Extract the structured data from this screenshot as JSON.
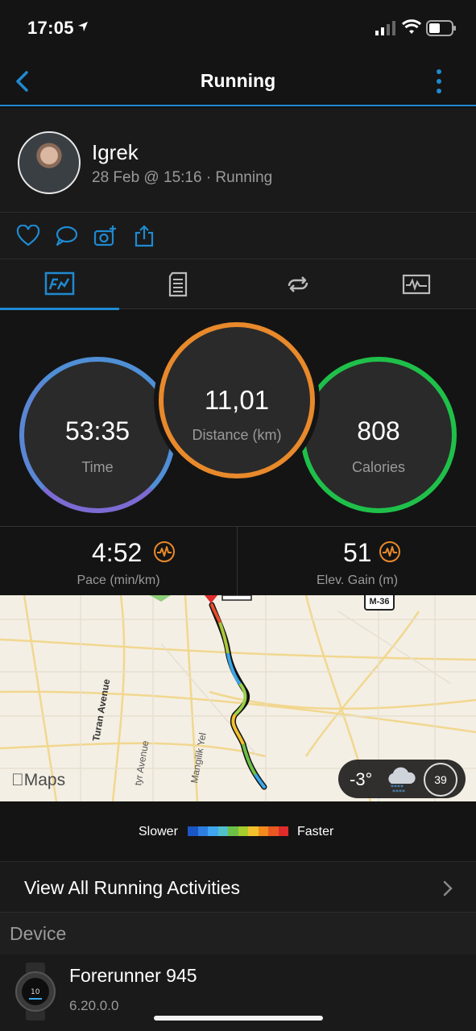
{
  "status_bar": {
    "time": "17:05"
  },
  "nav": {
    "title": "Running"
  },
  "profile": {
    "name": "Igrek",
    "meta": "28 Feb @ 15:16 · Running"
  },
  "actions": [
    "heart-icon",
    "comment-icon",
    "add-photo-icon",
    "share-icon"
  ],
  "tabs": [
    {
      "icon": "stats-icon",
      "active": true
    },
    {
      "icon": "details-icon",
      "active": false
    },
    {
      "icon": "laps-icon",
      "active": false
    },
    {
      "icon": "charts-icon",
      "active": false
    }
  ],
  "stats": {
    "time": {
      "value": "53:35",
      "label": "Time"
    },
    "distance": {
      "value": "11,01",
      "label": "Distance (km)"
    },
    "calories": {
      "value": "808",
      "label": "Calories"
    }
  },
  "secondary_stats": {
    "pace": {
      "value": "4:52",
      "label": "Pace (min/km)"
    },
    "elevation": {
      "value": "51",
      "label": "Elev. Gain (m)"
    }
  },
  "map": {
    "logo": "Maps",
    "shield": "M-36",
    "roads": [
      "Turan Avenue",
      "tyr Avenue",
      "Mangilik Yel"
    ],
    "weather": {
      "temperature": "-3°",
      "index": "39"
    }
  },
  "legend": {
    "slower": "Slower",
    "faster": "Faster",
    "colors": [
      "#1a56c4",
      "#2e7ee0",
      "#3fa6f0",
      "#52c0c8",
      "#6cc046",
      "#a6cc2e",
      "#f2c12e",
      "#f28a1e",
      "#e85820",
      "#e02b2b"
    ]
  },
  "view_all": "View All Running Activities",
  "section_device": "Device",
  "device": {
    "name": "Forerunner 945",
    "version": "6.20.0.0"
  },
  "colors": {
    "accent": "#1f8ad1",
    "time_ring": "#4f8fd6",
    "distance_ring": "#e8892b",
    "calories_ring": "#1fc04a",
    "orange_icon": "#e8892b"
  }
}
